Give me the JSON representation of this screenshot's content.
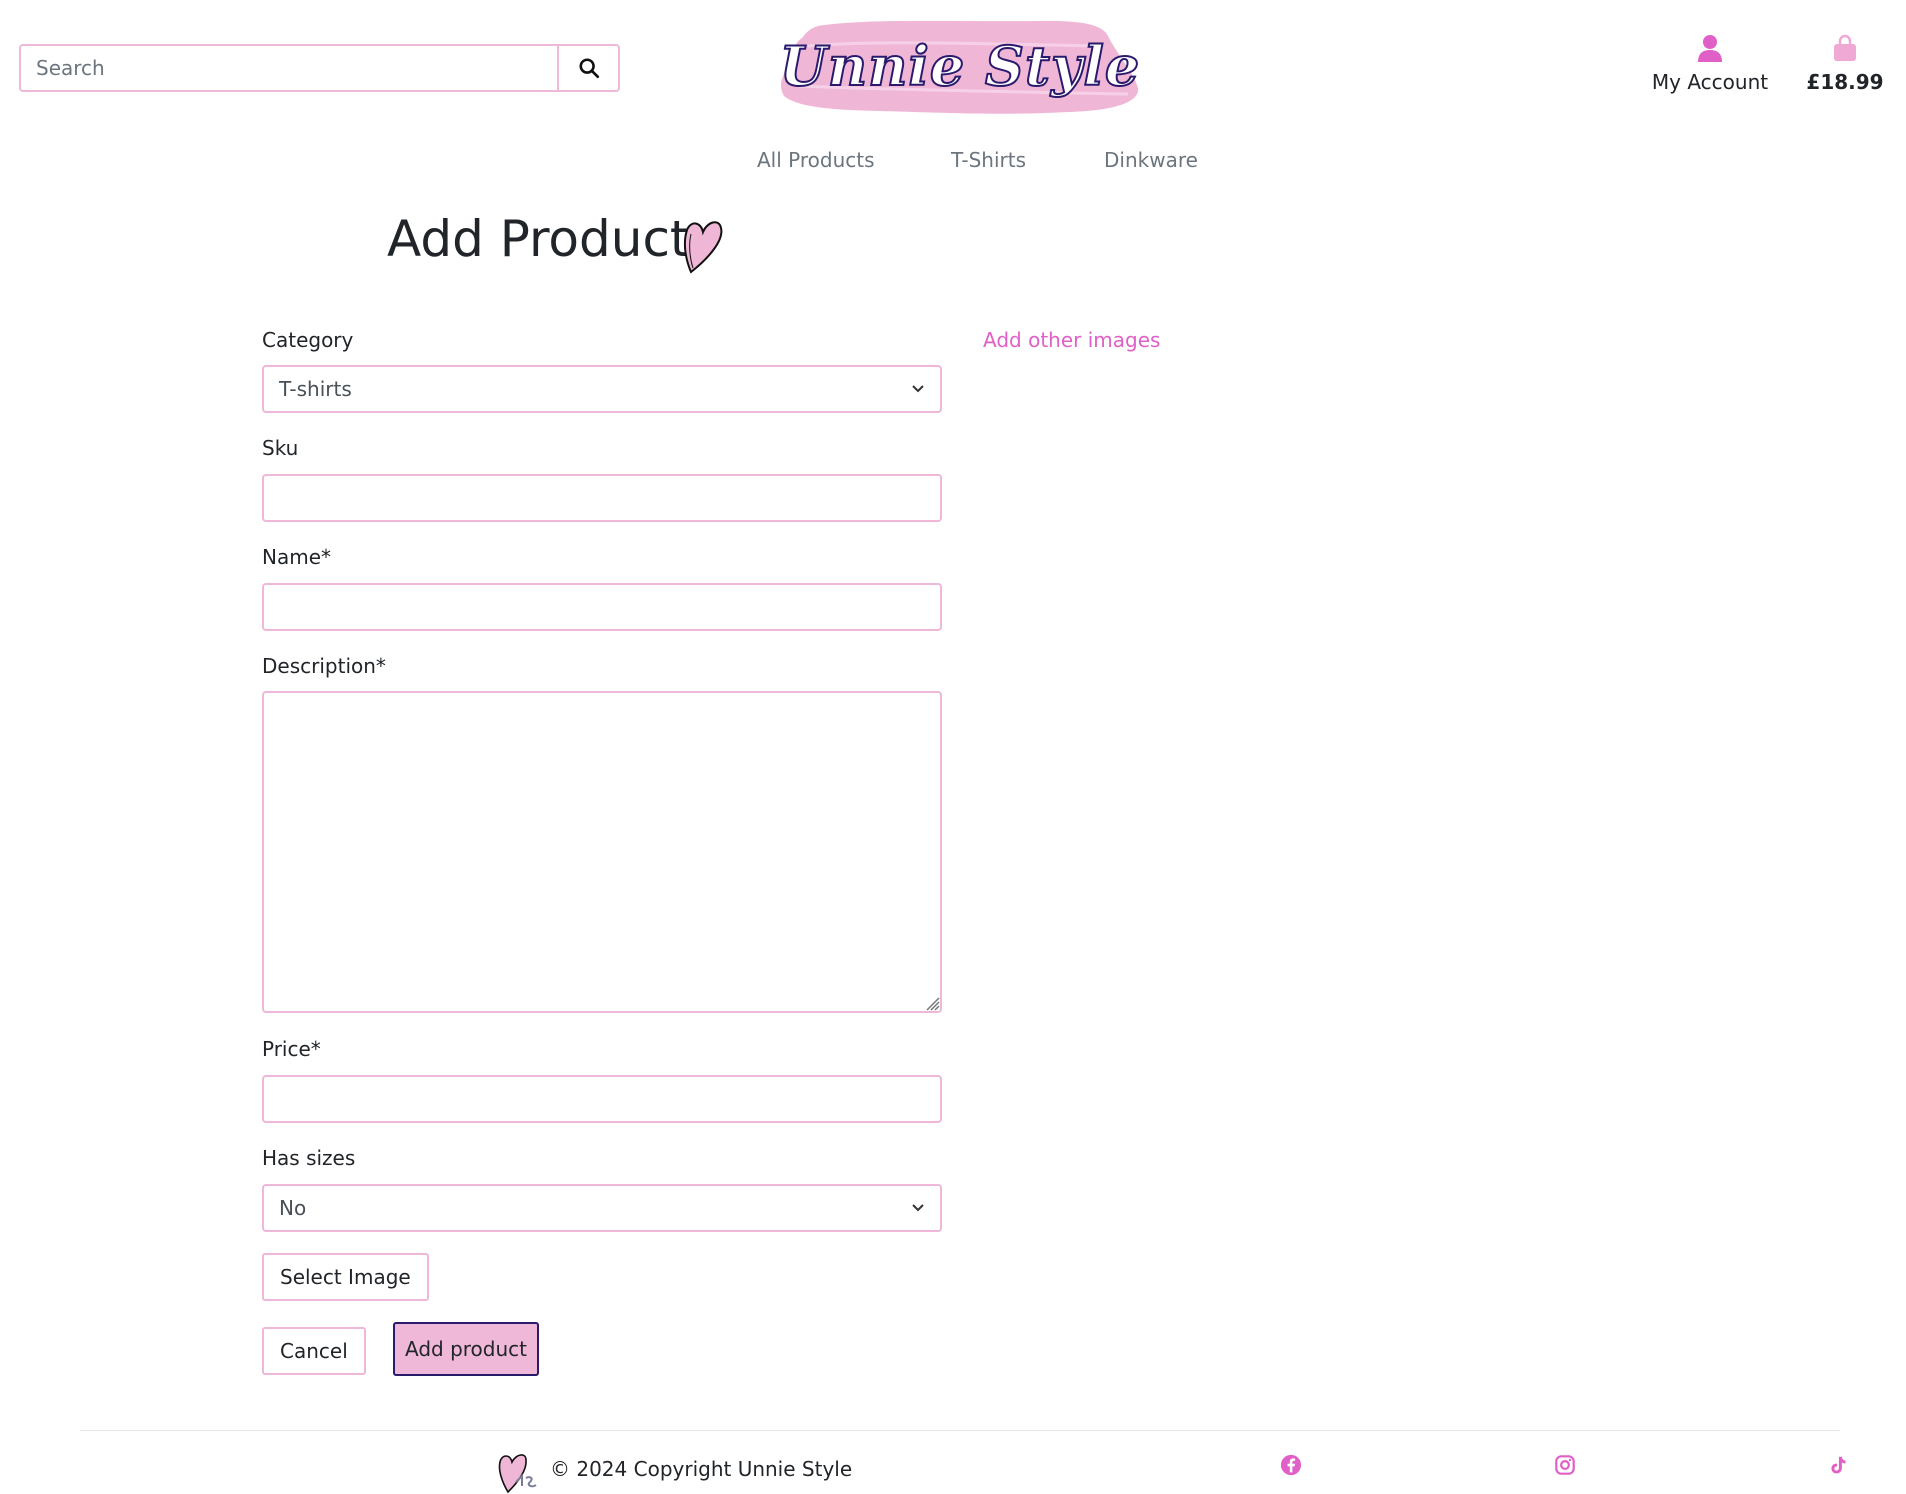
{
  "header": {
    "search_placeholder": "Search",
    "logo_text": "Unnie Style",
    "account_label": "My Account",
    "bag_total": "£18.99"
  },
  "nav": {
    "items": [
      "All Products",
      "T-Shirts",
      "Dinkware"
    ]
  },
  "page": {
    "title": "Add Product"
  },
  "form": {
    "category_label": "Category",
    "category_value": "T-shirts",
    "sku_label": "Sku",
    "name_label": "Name*",
    "description_label": "Description*",
    "price_label": "Price*",
    "has_sizes_label": "Has sizes",
    "has_sizes_value": "No",
    "select_image_label": "Select Image",
    "cancel_label": "Cancel",
    "submit_label": "Add product",
    "add_other_images_label": "Add other images"
  },
  "footer": {
    "copyright": "© 2024 Copyright Unnie Style",
    "socials": [
      "facebook-icon",
      "instagram-icon",
      "tiktok-icon"
    ]
  },
  "colors": {
    "accent_pink": "#e060c8",
    "border_pink": "#f0b8d8",
    "logo_bg": "#efb6d6",
    "logo_outline": "#2a1a6e"
  }
}
